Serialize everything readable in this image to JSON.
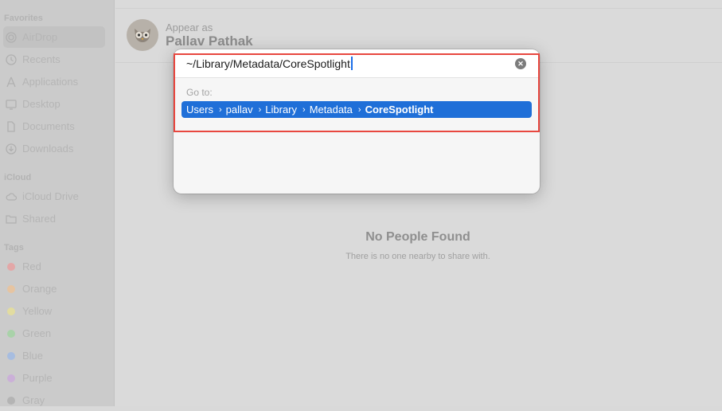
{
  "sidebar": {
    "favorites_title": "Favorites",
    "favorites": [
      {
        "label": "AirDrop",
        "icon": "airdrop-icon"
      },
      {
        "label": "Recents",
        "icon": "clock-icon"
      },
      {
        "label": "Applications",
        "icon": "applications-icon"
      },
      {
        "label": "Desktop",
        "icon": "desktop-icon"
      },
      {
        "label": "Documents",
        "icon": "document-icon"
      },
      {
        "label": "Downloads",
        "icon": "download-icon"
      }
    ],
    "icloud_title": "iCloud",
    "icloud": [
      {
        "label": "iCloud Drive",
        "icon": "cloud-icon"
      },
      {
        "label": "Shared",
        "icon": "shared-folder-icon"
      }
    ],
    "tags_title": "Tags",
    "tags": [
      {
        "label": "Red",
        "color": "#e3a7a7"
      },
      {
        "label": "Orange",
        "color": "#e6c4a1"
      },
      {
        "label": "Yellow",
        "color": "#e2dca0"
      },
      {
        "label": "Green",
        "color": "#a9d2a9"
      },
      {
        "label": "Blue",
        "color": "#a7bde0"
      },
      {
        "label": "Purple",
        "color": "#cbb0d8"
      },
      {
        "label": "Gray",
        "color": "#b4b4b4"
      }
    ]
  },
  "main": {
    "appear_label": "Appear as",
    "user_name": "Pallav Pathak",
    "empty_title": "No People Found",
    "empty_subtitle": "There is no one nearby to share with."
  },
  "dialog": {
    "path_value": "~/Library/Metadata/CoreSpotlight",
    "clear_icon": "clear-icon",
    "goto_label": "Go to:",
    "breadcrumb": [
      "Users",
      "pallav",
      "Library",
      "Metadata",
      "CoreSpotlight"
    ],
    "breadcrumb_color": "#1f6fd8"
  }
}
